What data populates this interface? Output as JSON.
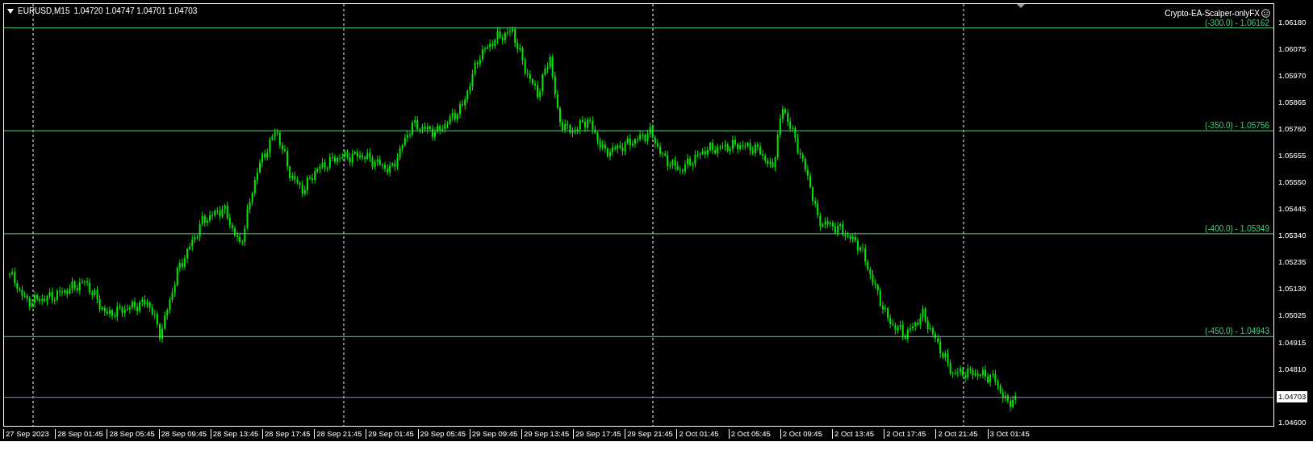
{
  "symbol_header": {
    "symbol": "EURUSD,M15",
    "prices": "1.04720 1.04747 1.04701 1.04703"
  },
  "indicator": {
    "name": "Crypto-EA-Scalper-onlyFX"
  },
  "levels": [
    {
      "label": "(-300.0) -  1.06162"
    },
    {
      "label": "(-350.0) -  1.05756"
    },
    {
      "label": "(-400.0) -  1.05349"
    },
    {
      "label": "(-450.0) -  1.04943"
    }
  ],
  "current_price": "1.04703",
  "price_axis": [
    "1.06180",
    "1.06075",
    "1.05970",
    "1.05865",
    "1.05760",
    "1.05655",
    "1.05550",
    "1.05445",
    "1.05340",
    "1.05235",
    "1.05130",
    "1.05025",
    "1.04915",
    "1.04810",
    "1.04600"
  ],
  "time_axis": [
    "27 Sep 2023",
    "28 Sep 01:45",
    "28 Sep 05:45",
    "28 Sep 09:45",
    "28 Sep 13:45",
    "28 Sep 17:45",
    "28 Sep 21:45",
    "29 Sep 01:45",
    "29 Sep 05:45",
    "29 Sep 09:45",
    "29 Sep 13:45",
    "29 Sep 17:45",
    "29 Sep 21:45",
    "2 Oct 01:45",
    "2 Oct 05:45",
    "2 Oct 09:45",
    "2 Oct 13:45",
    "2 Oct 17:45",
    "2 Oct 21:45",
    "3 Oct 01:45"
  ]
}
